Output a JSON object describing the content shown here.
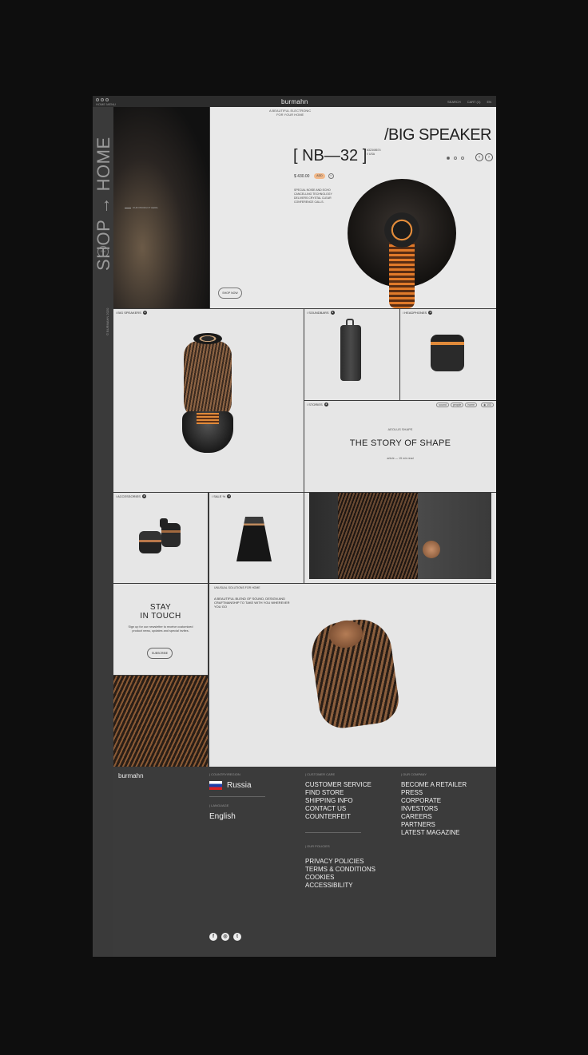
{
  "window": {
    "menu": "HOME MENU",
    "logo": "burmahn",
    "search": "SEARCH",
    "cart": "CART (1)",
    "account": "EN"
  },
  "sidebar": {
    "title": "SHOP → HOME",
    "badge": "EN",
    "copyright": "© BURMAHN 2020"
  },
  "hero": {
    "caption": "OUR PRODUCT HERE",
    "tagline_1": "A BEAUTIFUL ELECTRONIC",
    "tagline_2": "FOR YOUR HOME",
    "title": "/BIG SPEAKER",
    "model": "[ NB—32 ]",
    "model_sub_1": "#32345674",
    "model_sub_2": "// USA",
    "price": "$ 430.00",
    "add": "ADD",
    "heart": "♡",
    "description": "SPECIAL NOISE AND ECHO CANCELLING TECHNOLOGY DELIVERS CRYSTAL CLEAR CONFERENCE CALLS.",
    "shop_now": "SHOP NOW",
    "prev": "‹",
    "next": "›"
  },
  "categories": {
    "big_speakers": "/ BIG SPEAKERS",
    "soundbars": "/ SOUNDBARS",
    "headphones": "/ HEADPHONES",
    "stories": "/ STORIES",
    "accessories": "/ ACCESSORIES",
    "sale": "/ SALE %"
  },
  "story": {
    "subtitle": "AEOLUS SHAPE",
    "title": "THE STORY OF SHAPE",
    "meta": "article — 15 min read",
    "tags": [
      "sound",
      "people",
      "home"
    ],
    "views": "◉ 103"
  },
  "stay": {
    "title_1": "STAY",
    "title_2": "IN TOUCH",
    "text": "Sign up for our newsletter to receive customized product news, updates and special invites.",
    "subscribe": "SUBSCRIBE"
  },
  "main": {
    "top": "UNUSUAL SOLUTIONS FOR HOME",
    "headline": "A BEAUTIFUL BLEND OF SOUND, DESIGN AND CRAFTMANSHIP TO TAKE WITH YOU WHEREVER YOU GO"
  },
  "footer": {
    "logo": "burmahn",
    "country_heading": "COUNTRY/REGION",
    "country": "Russia",
    "language_heading": "LANGUAGE",
    "language": "English",
    "care_heading": "CUSTOMER CARE",
    "care_links": [
      "CUSTOMER SERVICE",
      "FIND STORE",
      "SHIPPING INFO",
      "CONTACT US",
      "COUNTERFEIT"
    ],
    "policies_heading": "OUR POLICIES",
    "policies_links": [
      "PRIVACY POLICIES",
      "TERMS & CONDITIONS",
      "COOKIES",
      "ACCESSIBILITY"
    ],
    "company_heading": "OUR COMPANY",
    "company_links": [
      "BECOME A RETAILER",
      "PRESS",
      "CORPORATE",
      "INVESTORS",
      "CAREERS",
      "PARTNERS",
      "LATEST MAGAZINE"
    ],
    "social": [
      "f",
      "◎",
      "t"
    ]
  },
  "colors": {
    "accent": "#e08a3a",
    "panel": "#e8e8e8",
    "frame": "#3a3a3a"
  }
}
